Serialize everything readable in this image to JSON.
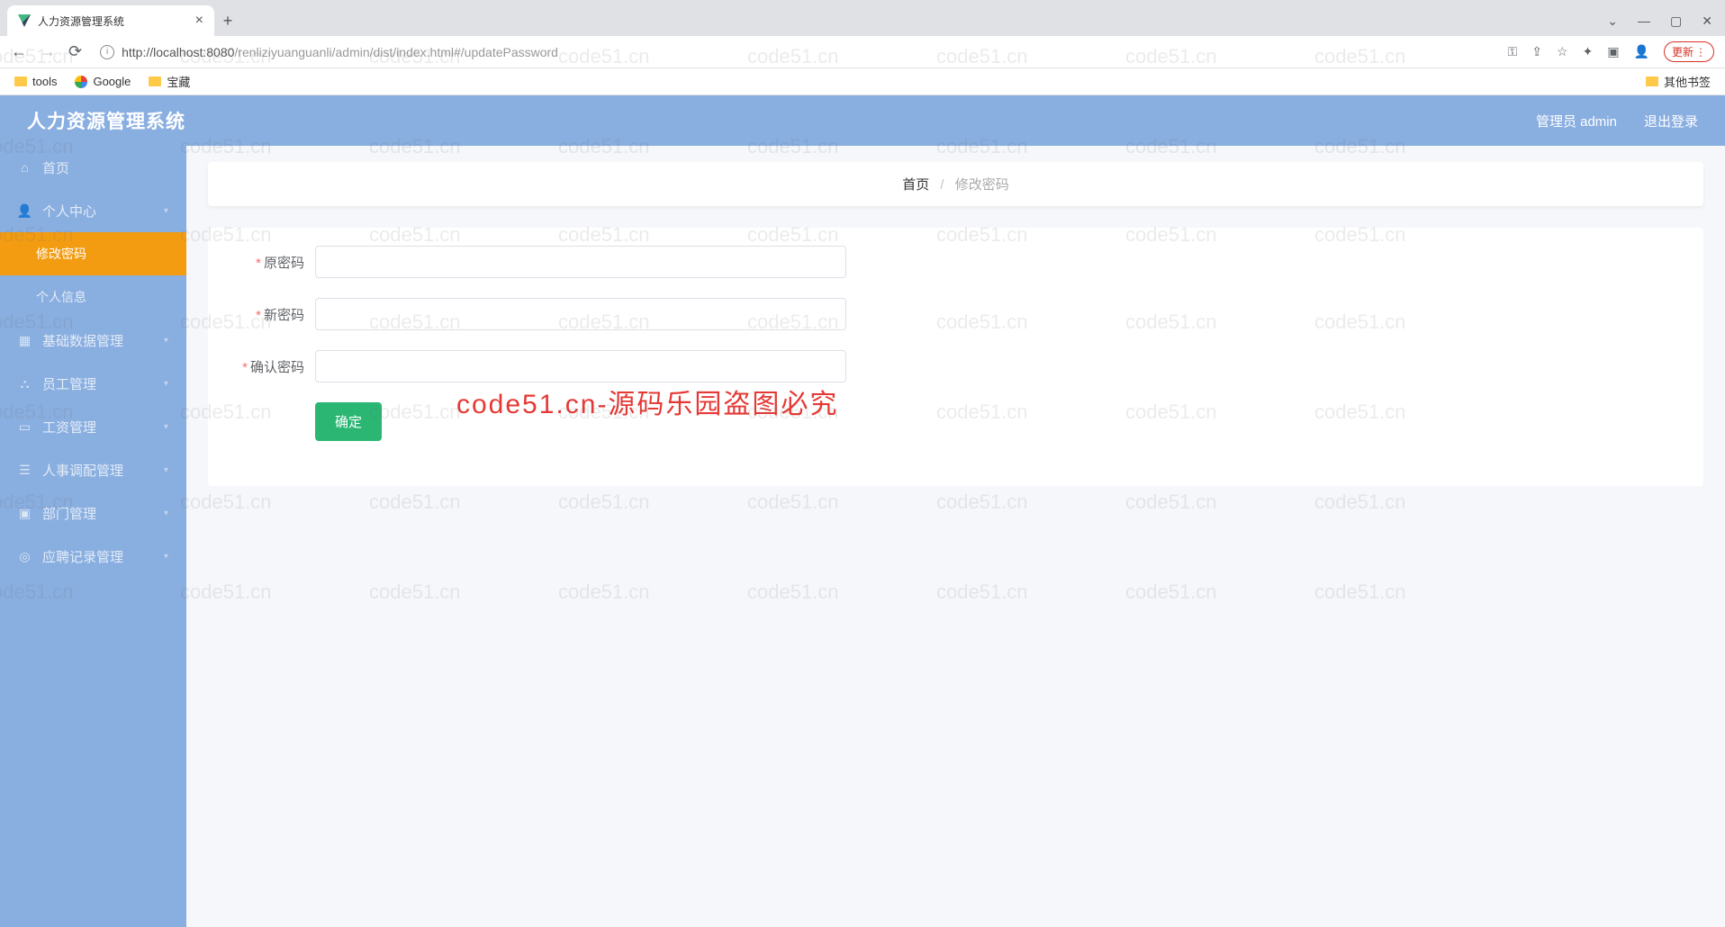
{
  "browser": {
    "tab_title": "人力资源管理系统",
    "url_host": "localhost:8080",
    "url_path": "/renliziyuanguanli/admin/dist/index.html#/updatePassword",
    "update_label": "更新",
    "bookmarks": {
      "tools": "tools",
      "google": "Google",
      "treasure": "宝藏",
      "other": "其他书签"
    }
  },
  "app": {
    "title": "人力资源管理系统",
    "user_label": "管理员 admin",
    "logout_label": "退出登录"
  },
  "sidebar": {
    "home": "首页",
    "personal": "个人中心",
    "change_pwd": "修改密码",
    "personal_info": "个人信息",
    "basic_data": "基础数据管理",
    "employee": "员工管理",
    "salary": "工资管理",
    "hr_transfer": "人事调配管理",
    "department": "部门管理",
    "recruit": "应聘记录管理"
  },
  "breadcrumb": {
    "home": "首页",
    "current": "修改密码"
  },
  "form": {
    "old_pwd_label": "原密码",
    "new_pwd_label": "新密码",
    "confirm_pwd_label": "确认密码",
    "submit_label": "确定"
  },
  "watermark": {
    "bg": "code51.cn",
    "red": "code51.cn-源码乐园盗图必究"
  }
}
